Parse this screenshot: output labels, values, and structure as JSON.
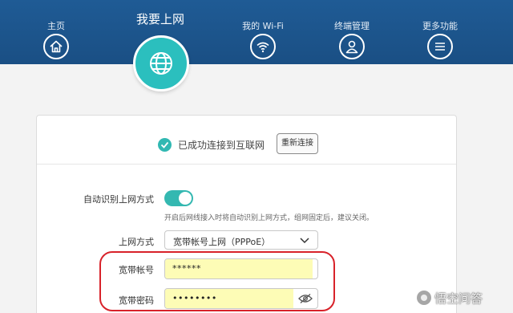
{
  "nav": {
    "home": {
      "label": "主页",
      "icon": "home-icon"
    },
    "internet": {
      "label": "我要上网",
      "icon": "globe-icon"
    },
    "wifi": {
      "label": "我的 Wi-Fi",
      "icon": "wifi-icon"
    },
    "devices": {
      "label": "终端管理",
      "icon": "user-icon"
    },
    "more": {
      "label": "更多功能",
      "icon": "menu-icon"
    }
  },
  "status": {
    "text": "已成功连接到互联网",
    "reconnect_label": "重新连接"
  },
  "form": {
    "auto_detect": {
      "label": "自动识别上网方式",
      "enabled": true,
      "hint": "开启后网线接入时将自动识别上网方式，组网固定后，建议关闭。"
    },
    "mode": {
      "label": "上网方式",
      "value": "宽带帐号上网（PPPoE）"
    },
    "account": {
      "label": "宽带帐号",
      "value": "******"
    },
    "password": {
      "label": "宽带密码",
      "value": "••••••••"
    }
  },
  "watermark": {
    "text": "悟空问答"
  },
  "colors": {
    "header": "#1f5b95",
    "accent": "#2bbfbe",
    "highlight": "#d8222a",
    "autofill": "#fdfcb6"
  }
}
